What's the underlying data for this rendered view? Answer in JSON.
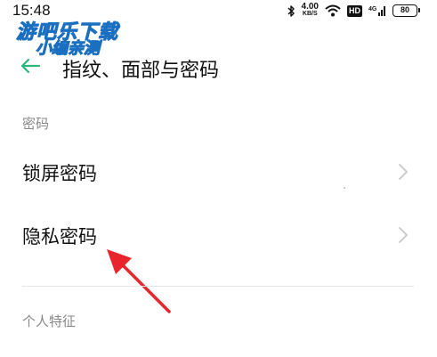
{
  "status_bar": {
    "time": "15:48",
    "net_speed_value": "4.00",
    "net_speed_unit": "KB/S",
    "hd_badge": "HD",
    "battery_level": "80",
    "icons": [
      "bluetooth-icon",
      "wifi-icon",
      "hd-icon",
      "4g-signal-icon",
      "battery-icon"
    ]
  },
  "watermark": {
    "line1": "游吧乐下载",
    "line2": "小编亲测"
  },
  "header": {
    "title": "指纹、面部与密码"
  },
  "sections": [
    {
      "label": "密码",
      "items": [
        {
          "label": "锁屏密码"
        },
        {
          "label": "隐私密码"
        }
      ]
    },
    {
      "label": "个人特征"
    }
  ],
  "colors": {
    "accent": "#2cb67a",
    "annotation_arrow": "#e8242c",
    "watermark": "#3aa0f0",
    "section_label": "#888888",
    "chevron": "#c8c8c8"
  }
}
